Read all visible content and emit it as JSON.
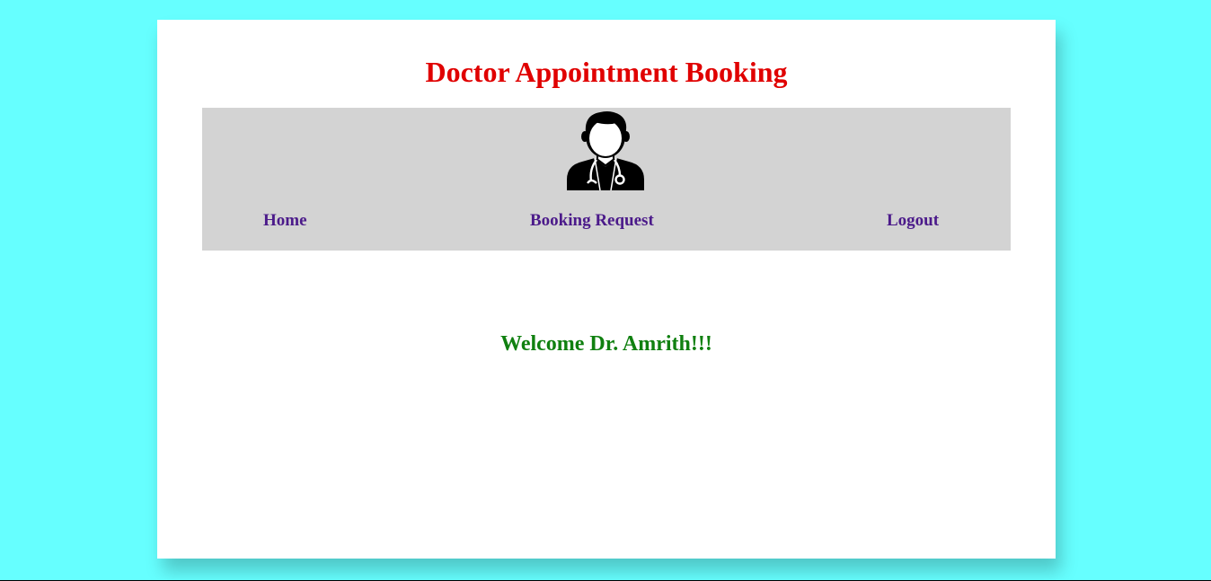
{
  "header": {
    "title": "Doctor Appointment Booking"
  },
  "nav": {
    "logo_icon": "doctor-icon",
    "items": [
      {
        "label": "Home"
      },
      {
        "label": "Booking Request"
      },
      {
        "label": "Logout"
      }
    ]
  },
  "main": {
    "welcome_message": "Welcome Dr. Amrith!!!"
  },
  "colors": {
    "page_background": "#66ffff",
    "card_background": "#ffffff",
    "navbar_background": "#d3d3d3",
    "title": "#e00000",
    "nav_link": "#4b1a8a",
    "welcome": "#108010"
  }
}
